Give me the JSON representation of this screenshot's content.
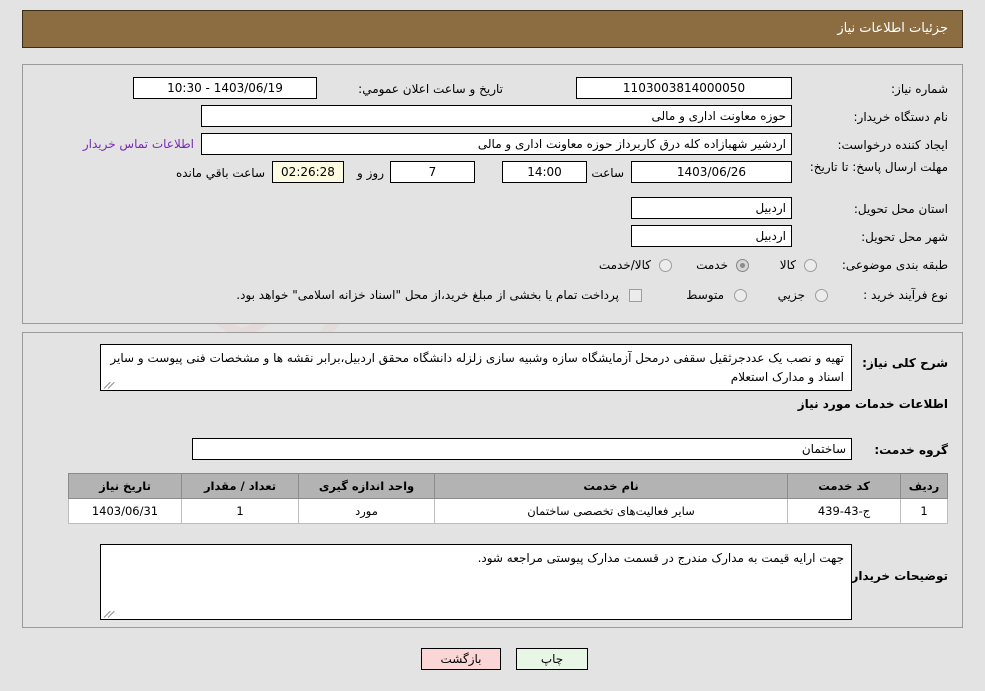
{
  "header": {
    "title": "جزئیات اطلاعات نیاز"
  },
  "info": {
    "need_number_label": "شماره نیاز:",
    "need_number_value": "1103003814000050",
    "announce_datetime_label": "تاریخ و ساعت اعلان عمومي:",
    "announce_datetime_value": "1403/06/19 - 10:30",
    "buyer_org_label": "نام دستگاه خریدار:",
    "buyer_org_value": "حوزه معاونت اداری و مالی",
    "creator_label": "ایجاد کننده درخواست:",
    "creator_value": "اردشیر شهبازاده کله درق کاربرداز حوزه معاونت اداری و مالی",
    "contact_link": "اطلاعات تماس خریدار",
    "deadline_label": "مهلت ارسال پاسخ: تا تاریخ:",
    "deadline_date": "1403/06/26",
    "deadline_hour_label": "ساعت",
    "deadline_hour_value": "14:00",
    "remaining_days_value": "7",
    "remaining_days_label": "روز و",
    "remaining_time_value": "02:26:28",
    "remaining_time_label": "ساعت باقي مانده",
    "province_label": "استان محل تحویل:",
    "province_value": "اردبیل",
    "city_label": "شهر محل تحویل:",
    "city_value": "اردبیل",
    "category_label": "طبقه بندی موضوعی:",
    "category_options": [
      {
        "label": "کالا",
        "selected": false
      },
      {
        "label": "خدمت",
        "selected": true
      },
      {
        "label": "کالا/خدمت",
        "selected": false
      }
    ],
    "process_label": "نوع فرآیند خرید :",
    "process_options": [
      {
        "label": "جزیي",
        "selected": false
      },
      {
        "label": "متوسط",
        "selected": false
      }
    ],
    "treasury_checkbox_label": "پرداخت تمام یا بخشی از مبلغ خرید،از محل \"اسناد خزانه اسلامی\" خواهد بود.",
    "treasury_checked": false
  },
  "description": {
    "label": "شرح کلی نیاز:",
    "value": "تهیه و نصب یک عددجرثقیل سقفی درمحل آزمایشگاه سازه وشبیه سازی زلزله دانشگاه محقق اردبیل،برابر نقشه ها و مشخصات فنی پیوست و سایر اسناد و مدارک استعلام"
  },
  "services": {
    "section_title": "اطلاعات خدمات مورد نیاز",
    "group_label": "گروه خدمت:",
    "group_value": "ساختمان",
    "columns": [
      "ردیف",
      "کد خدمت",
      "نام خدمت",
      "واحد اندازه گیری",
      "تعداد / مقدار",
      "تاریخ نیاز"
    ],
    "rows": [
      {
        "index": "1",
        "code": "ج-43-439",
        "name": "سایر فعالیت‌های تخصصی ساختمان",
        "unit": "مورد",
        "quantity": "1",
        "need_date": "1403/06/31"
      }
    ]
  },
  "buyer_notes": {
    "label": "توضیحات خریدار:",
    "value": "جهت ارایه قیمت به مدارک مندرج در قسمت مدارک پیوستی مراجعه شود."
  },
  "footer": {
    "print_label": "چاپ",
    "back_label": "بازگشت"
  },
  "watermark": {
    "text": "AriaTender.net"
  },
  "colors": {
    "header_brown": "#8c6d42",
    "page_background": "#e3e3e3",
    "table_header_gray": "#b3b3b3",
    "link_purple": "#7a2ab5",
    "print_button_green": "#e8f6e6",
    "back_button_pink": "#fbd6d6",
    "highlight_cream": "#fdfbe2"
  }
}
